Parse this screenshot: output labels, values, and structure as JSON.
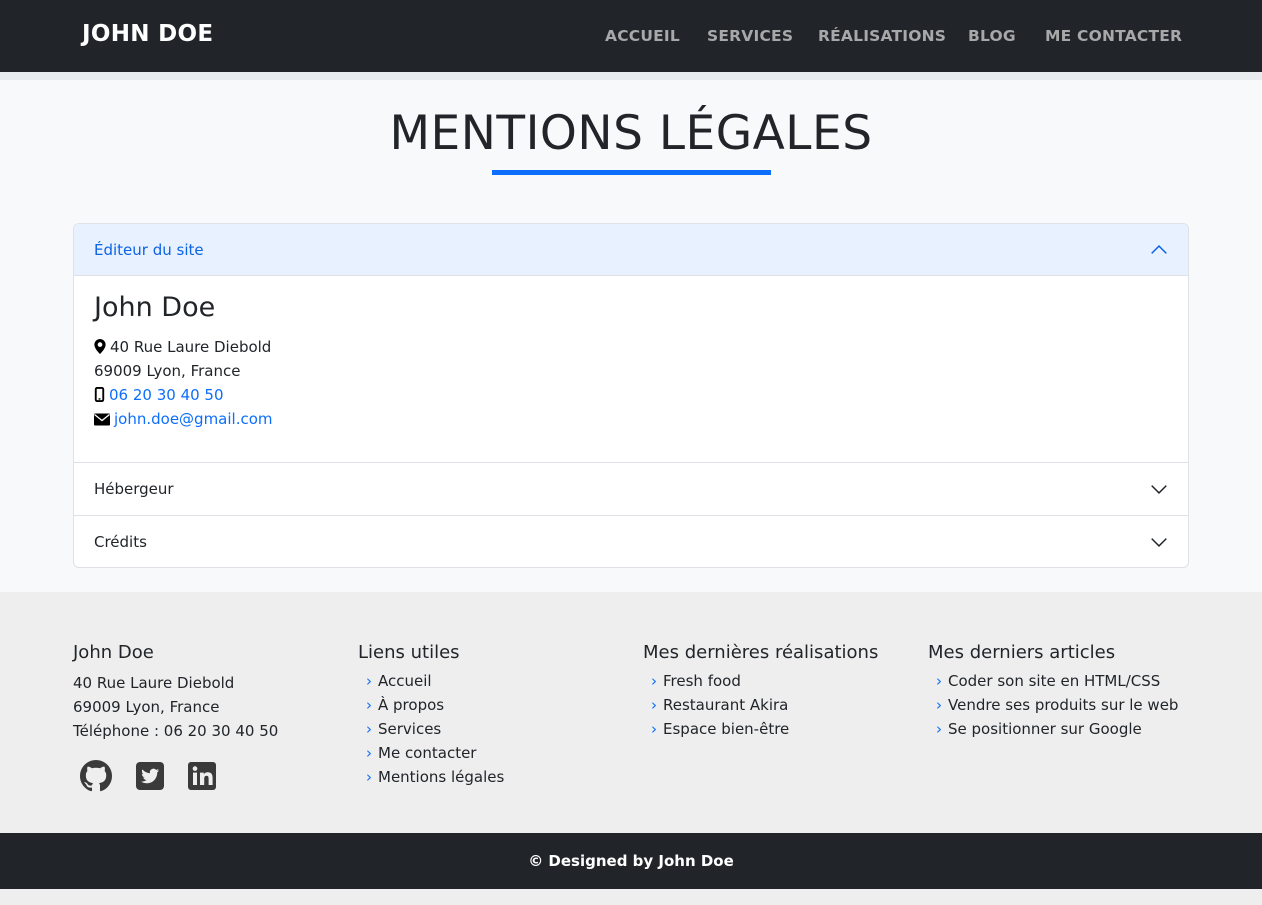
{
  "navbar": {
    "brand": "JOHN DOE",
    "links": [
      "ACCUEIL",
      "SERVICES",
      "RÉALISATIONS",
      "BLOG",
      "ME CONTACTER"
    ]
  },
  "main": {
    "title": "MENTIONS LÉGALES",
    "accordion": {
      "items": [
        {
          "label": "Éditeur du site",
          "state": "expanded"
        },
        {
          "label": "Hébergeur",
          "state": "collapsed"
        },
        {
          "label": "Crédits",
          "state": "collapsed"
        }
      ],
      "editor": {
        "name": "John Doe",
        "street": "40 Rue Laure Diebold",
        "city": "69009 Lyon, France",
        "phone": "06 20 30 40 50",
        "email": "john.doe@gmail.com"
      }
    }
  },
  "footer": {
    "contact": {
      "heading": "John Doe",
      "street": "40 Rue Laure Diebold",
      "city": "69009 Lyon, France",
      "phone": "Téléphone : 06 20 30 40 50"
    },
    "useful_links": {
      "heading": "Liens utiles",
      "items": [
        "Accueil",
        "À propos",
        "Services",
        "Me contacter",
        "Mentions légales"
      ]
    },
    "projects": {
      "heading": "Mes dernières réalisations",
      "items": [
        "Fresh food",
        "Restaurant Akira",
        "Espace bien-être"
      ]
    },
    "articles": {
      "heading": "Mes derniers articles",
      "items": [
        "Coder son site en HTML/CSS",
        "Vendre ses produits sur le web",
        "Se positionner sur Google"
      ]
    },
    "socials": [
      "github-icon",
      "twitter-icon",
      "linkedin-icon"
    ],
    "copyright": "© Designed by John Doe"
  },
  "colors": {
    "navbar_bg": "#212529",
    "accent": "#0d6efd",
    "accordion_active_bg": "#e7f1ff",
    "page_bg": "#f8f9fa",
    "footer_bg": "#eeeeee"
  }
}
